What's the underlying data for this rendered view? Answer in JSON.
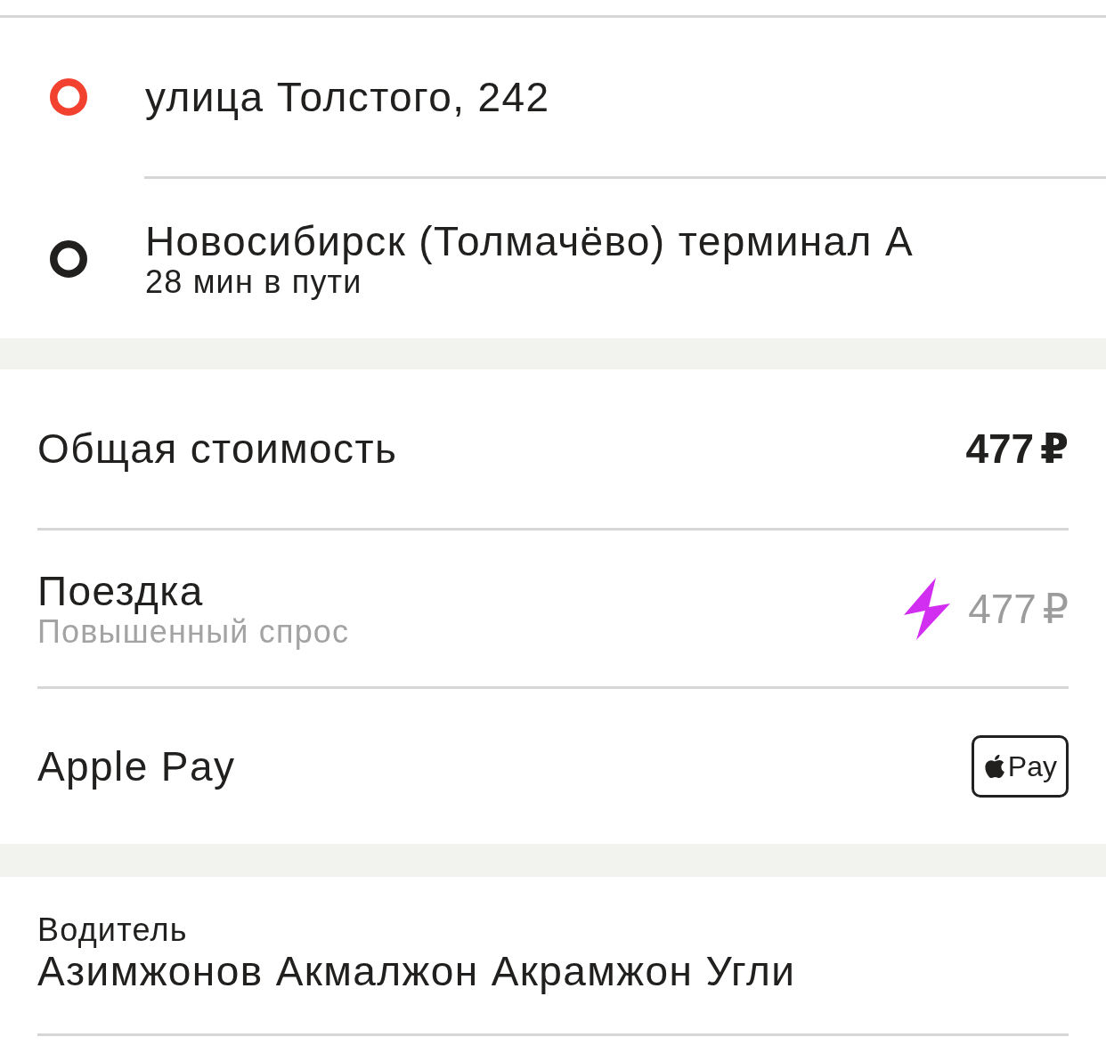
{
  "route": {
    "points": [
      {
        "color": "#f2412f",
        "address": "улица Толстого, 242"
      },
      {
        "color": "#21201f",
        "address": "Новосибирск (Толмачёво) терминал А",
        "note": "28 мин в пути"
      }
    ]
  },
  "cost": {
    "rows": [
      {
        "kind": "total",
        "label": "Общая стоимость",
        "amount": "477 ₽"
      },
      {
        "kind": "trip",
        "label": "Поездка",
        "note": "Повышенный спрос",
        "surge": true,
        "amount": "477 ₽"
      },
      {
        "kind": "payment",
        "label": "Apple Pay",
        "badge": "Pay"
      }
    ]
  },
  "driver": {
    "caption": "Водитель",
    "name": "Азимжонов Акмалжон Акрамжон Угли"
  }
}
